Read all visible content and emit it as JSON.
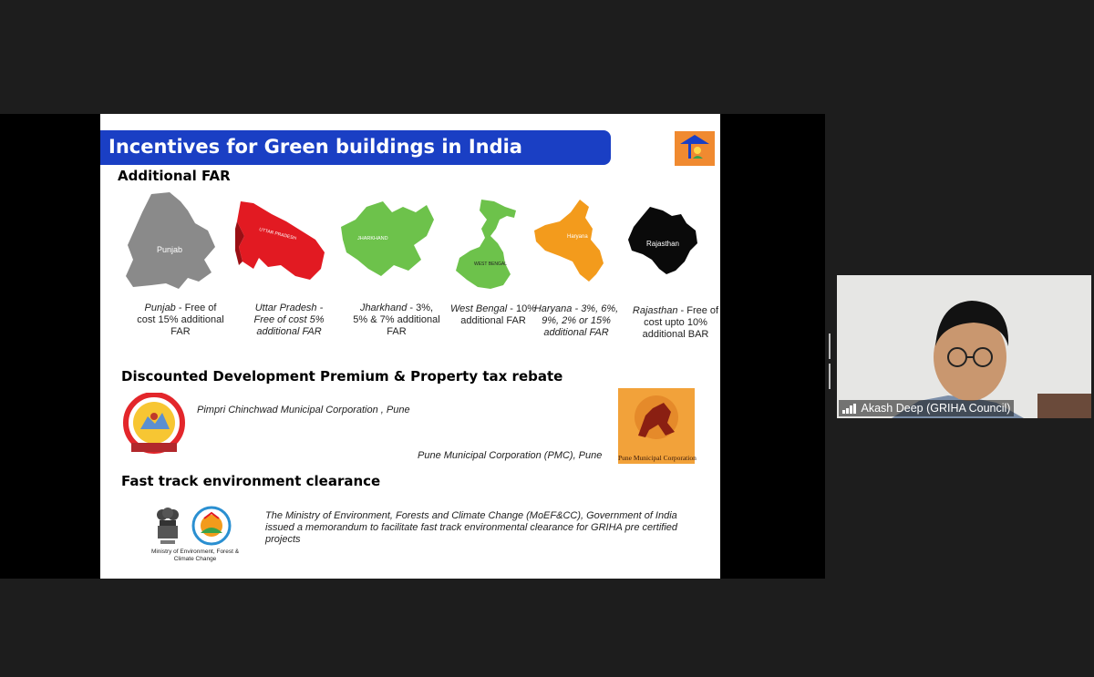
{
  "slide": {
    "title": "Incentives for Green buildings in India",
    "sections": {
      "far": "Additional FAR",
      "premium": "Discounted Development Premium & Property tax rebate",
      "clearance": "Fast track environment clearance"
    },
    "states": [
      {
        "map_label": "Punjab",
        "caption_state": "Punjab",
        "caption_detail": "- Free of cost 15% additional FAR",
        "color": "#8a8a8a"
      },
      {
        "map_label": "UTTAR PRADESH",
        "caption_state": "Uttar Pradesh",
        "caption_detail": "- Free of cost 5% additional FAR",
        "color": "#e21a22"
      },
      {
        "map_label": "JHARKHAND",
        "caption_state": "Jharkhand",
        "caption_detail": "- 3%, 5% & 7% additional FAR",
        "color": "#6dc24b"
      },
      {
        "map_label": "WEST BENGAL",
        "caption_state": "West Bengal",
        "caption_detail": "- 10% additional FAR",
        "color": "#6dc24b"
      },
      {
        "map_label": "Haryana",
        "caption_state": "Haryana",
        "caption_detail": "- 3%, 6%, 9%, 2% or 15% additional FAR",
        "color": "#f39b1c"
      },
      {
        "map_label": "Rajasthan",
        "caption_state": "Rajasthan",
        "caption_detail": "- Free of cost upto 10% additional BAR",
        "color": "#0a0a0a"
      }
    ],
    "corporations": {
      "pcmc": "Pimpri Chinchwad Municipal Corporation  , Pune",
      "pmc": "Pune Municipal Corporation (PMC), Pune",
      "pmc_logo_text": "Pune Municipal Corporation"
    },
    "clearance_text": "The Ministry of Environment, Forests and Climate Change (MoEF&CC), Government of India issued a memorandum to facilitate fast track environmental clearance for GRIHA pre certified projects",
    "ministry_label": "Ministry of Environment, Forest & Climate Change"
  },
  "participant": {
    "name": "Akash Deep (GRIHA Council)"
  },
  "colors": {
    "title_bar": "#1a3fc4",
    "background": "#1d1d1d",
    "logo_orange": "#f08a30"
  },
  "icons": {
    "signal": "signal-bars-icon",
    "splitter": "drag-handle-icon"
  }
}
